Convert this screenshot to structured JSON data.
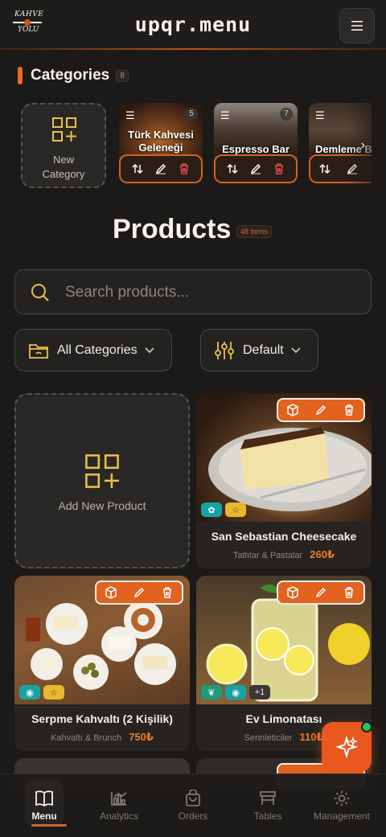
{
  "header": {
    "logo_top": "KAHVE",
    "logo_bottom": "YOLU",
    "brand": "upqr.menu",
    "menu_icon": "hamburger-icon"
  },
  "categories": {
    "title": "Categories",
    "count": "8",
    "new_label_line1": "New",
    "new_label_line2": "Category",
    "items": [
      {
        "name": "Türk Kahvesi Geleneği",
        "count": "5"
      },
      {
        "name": "Espresso Bar",
        "count": "7"
      },
      {
        "name": "Demleme B",
        "count": ""
      }
    ]
  },
  "products": {
    "title": "Products",
    "count_label": "48 items",
    "search_placeholder": "Search products...",
    "filter_category": "All Categories",
    "filter_sort": "Default",
    "new_label": "Add New Product",
    "items": [
      {
        "name": "San Sebastian Cheesecake",
        "category": "Tatlılar & Pastalar",
        "price": "260₺",
        "tags": [
          "vegetarian",
          "star"
        ],
        "more": ""
      },
      {
        "name": "Serpme Kahvaltı (2 Kişilik)",
        "category": "Kahvaltı & Brunch",
        "price": "750₺",
        "tags": [
          "halal",
          "star"
        ],
        "more": ""
      },
      {
        "name": "Ev Limonatası",
        "category": "Serinleticiler",
        "price": "110₺",
        "tags": [
          "leaf",
          "halal"
        ],
        "more": "+1"
      }
    ]
  },
  "nav": {
    "items": [
      {
        "label": "Menu",
        "icon": "book-icon",
        "active": true
      },
      {
        "label": "Analytics",
        "icon": "chart-icon",
        "active": false
      },
      {
        "label": "Orders",
        "icon": "bag-icon",
        "active": false
      },
      {
        "label": "Tables",
        "icon": "table-icon",
        "active": false
      },
      {
        "label": "Management",
        "icon": "gear-icon",
        "active": false
      }
    ]
  },
  "colors": {
    "accent": "#ef6a21",
    "background": "#1c1a18",
    "card": "#262320",
    "status_online": "#22c55e"
  }
}
